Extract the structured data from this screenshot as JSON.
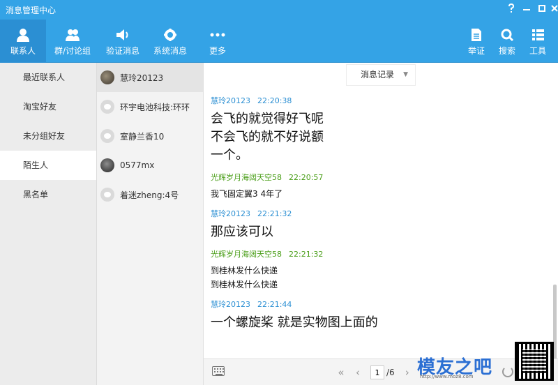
{
  "window": {
    "title": "消息管理中心"
  },
  "toolbar": {
    "left": [
      {
        "label": "联系人",
        "icon": "person-icon"
      },
      {
        "label": "群/讨论组",
        "icon": "group-icon"
      },
      {
        "label": "验证消息",
        "icon": "speaker-icon"
      },
      {
        "label": "系统消息",
        "icon": "gear-icon"
      },
      {
        "label": "更多",
        "icon": "more-icon"
      }
    ],
    "right": [
      {
        "label": "举证",
        "icon": "document-icon"
      },
      {
        "label": "搜索",
        "icon": "search-icon"
      },
      {
        "label": "工具",
        "icon": "list-icon"
      }
    ]
  },
  "categories": [
    "最近联系人",
    "淘宝好友",
    "未分组好友",
    "陌生人",
    "黑名单"
  ],
  "contacts": [
    "慧玲20123",
    "环宇电池科技:环环",
    "室静兰香10",
    "0577mx",
    "着迷zheng:4号"
  ],
  "history": {
    "label": "消息记录"
  },
  "messages": [
    {
      "name": "慧玲20123",
      "time": "22:20:38",
      "color": "blue",
      "size": "big",
      "lines": [
        "会飞的就觉得好飞呢",
        "不会飞的就不好说额",
        "一个。"
      ]
    },
    {
      "name": "光辉岁月海阔天空58",
      "time": "22:20:57",
      "color": "green",
      "size": "small",
      "lines": [
        "我飞固定翼3  4年了"
      ]
    },
    {
      "name": "慧玲20123",
      "time": "22:21:32",
      "color": "blue",
      "size": "big",
      "lines": [
        "那应该可以"
      ]
    },
    {
      "name": "光辉岁月海阔天空58",
      "time": "22:21:32",
      "color": "green",
      "size": "small",
      "lines": [
        "到桂林发什么快递",
        "到桂林发什么快递"
      ]
    },
    {
      "name": "慧玲20123",
      "time": "22:21:44",
      "color": "blue",
      "size": "big",
      "lines": [
        "一个螺旋桨  就是实物图上面的"
      ]
    }
  ],
  "pager": {
    "current": "1",
    "total": "/6"
  },
  "watermark": {
    "text": "模友之吧",
    "url": "http://www.moz8.com"
  },
  "colors": {
    "accent": "#34a3e6",
    "name_blue": "#2b8fd3",
    "name_green": "#4a9e18"
  }
}
